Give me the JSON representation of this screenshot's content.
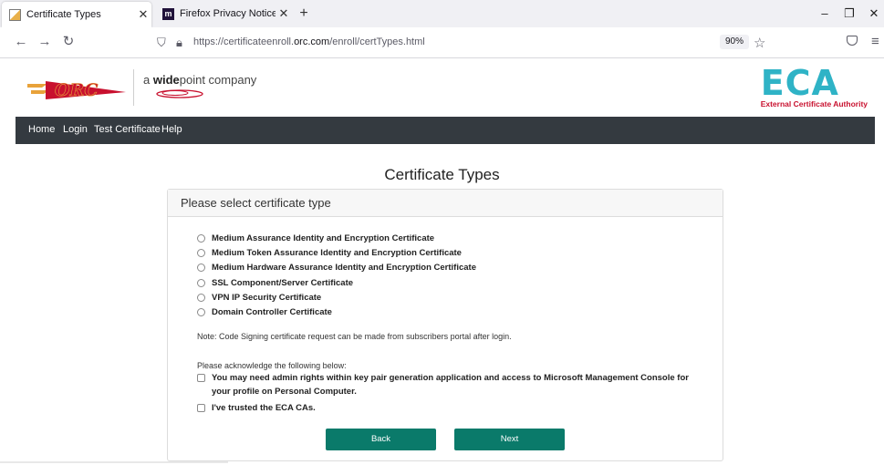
{
  "browser": {
    "tabs": [
      {
        "label": "Certificate Types",
        "active": true
      },
      {
        "label": "Firefox Privacy Notice — Mozill",
        "active": false
      }
    ],
    "new_tab_symbol": "+",
    "close_symbol": "✕",
    "url_prefix": "https://certificateenroll.",
    "url_domain": "orc.com",
    "url_suffix": "/enroll/certTypes.html",
    "zoom": "90%"
  },
  "header": {
    "orc_text": "ORC",
    "partner_prefix": "a ",
    "partner_bold": "wide",
    "partner_rest": "point company",
    "eca_big": "ECA",
    "eca_small": "External Certificate Authority"
  },
  "nav": {
    "items": [
      "Home",
      "Login",
      "Test Certificate",
      "Help"
    ]
  },
  "main": {
    "title": "Certificate Types",
    "card_heading": "Please select certificate type",
    "options": [
      "Medium Assurance Identity and Encryption Certificate",
      "Medium Token Assurance Identity and Encryption Certificate",
      "Medium Hardware Assurance Identity and Encryption Certificate",
      "SSL Component/Server Certificate",
      "VPN IP Security Certificate",
      "Domain Controller Certificate"
    ],
    "note": "Note: Code Signing certificate request can be made from subscribers portal after login.",
    "ack_label": "Please acknowledge the following below:",
    "ack_items": [
      "You may need admin rights within key pair generation application and access to Microsoft Management Console for your profile on Personal Computer.",
      "I've trusted the ECA CAs."
    ],
    "back_label": "Back",
    "next_label": "Next"
  },
  "colors": {
    "nav_bg": "#343a40",
    "button_bg": "#0a7a6a",
    "eca_blue": "#2fb3c6",
    "eca_red": "#c8102e"
  }
}
